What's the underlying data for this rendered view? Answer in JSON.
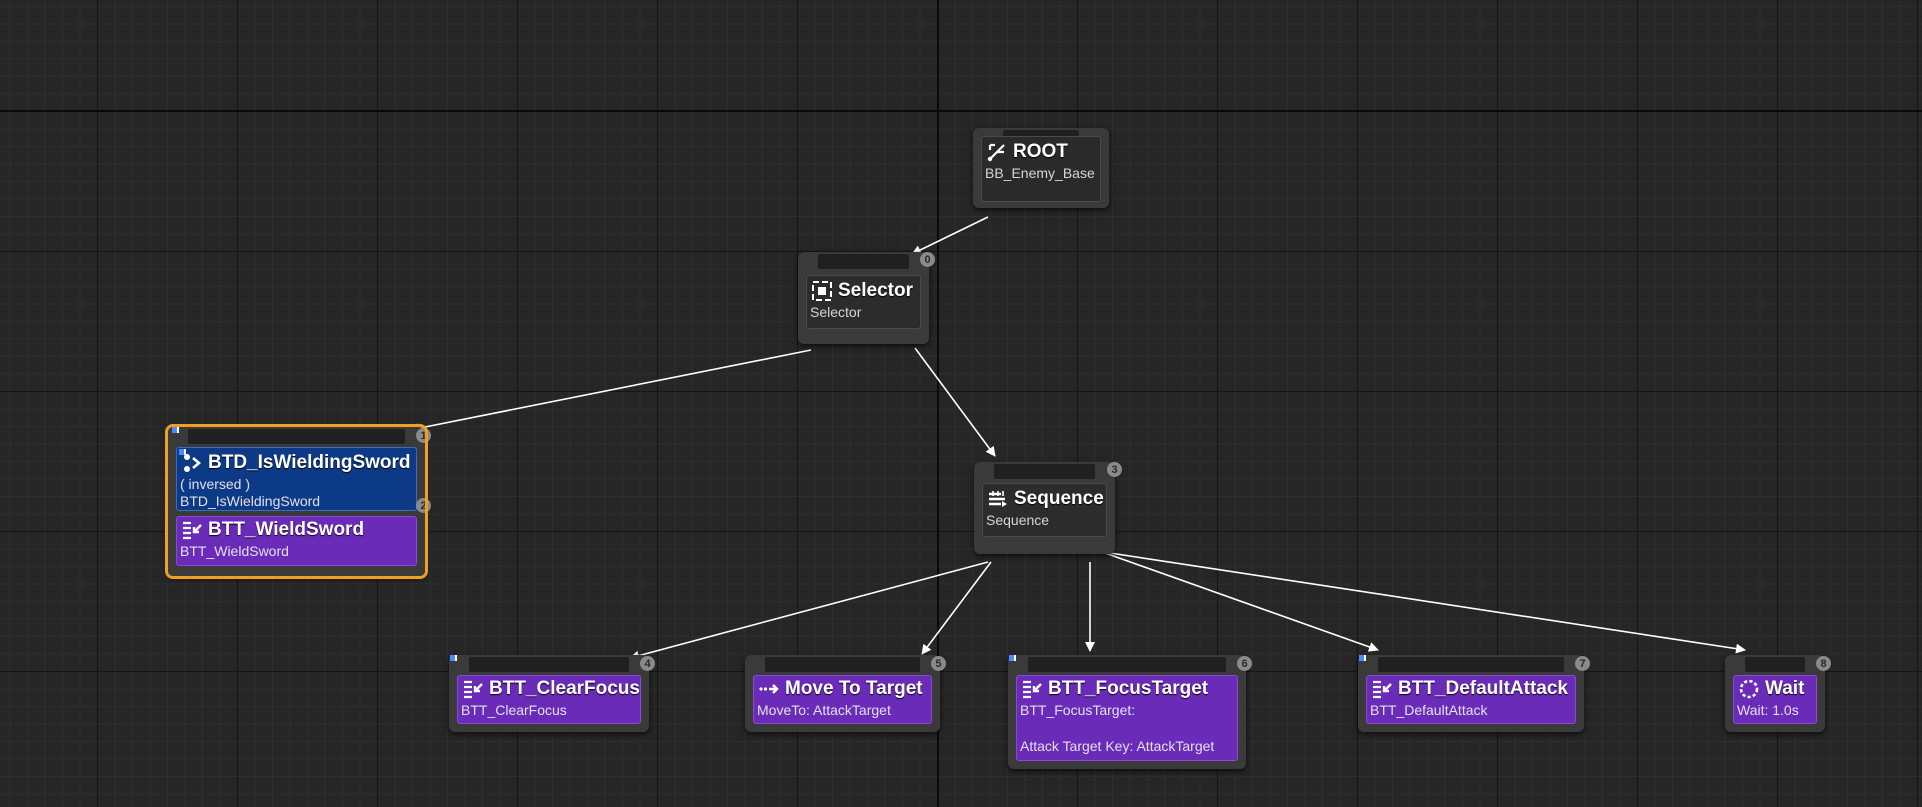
{
  "colors": {
    "composite": "#3a3a3a",
    "task": "#6a2bb8",
    "decorator": "#0d3a86",
    "selection": "#f0a020",
    "wire": "#ffffff"
  },
  "nodes": {
    "root": {
      "title": "ROOT",
      "subtitle": "BB_Enemy_Base",
      "icon": "root-icon"
    },
    "selector": {
      "title": "Selector",
      "subtitle": "Selector",
      "index": "0",
      "icon": "selector-icon"
    },
    "sequence": {
      "title": "Sequence",
      "subtitle": "Sequence",
      "index": "3",
      "icon": "sequence-icon"
    },
    "decorator": {
      "title": "BTD_IsWieldingSword",
      "line1": "( inversed )",
      "line2": "BTD_IsWieldingSword",
      "index": "2",
      "icon": "decorator-icon"
    },
    "wield_sword": {
      "title": "BTT_WieldSword",
      "subtitle": "BTT_WieldSword",
      "index": "1",
      "icon": "task-icon"
    },
    "clear_focus": {
      "title": "BTT_ClearFocus",
      "subtitle": "BTT_ClearFocus",
      "index": "4",
      "icon": "task-icon"
    },
    "move_to": {
      "title": "Move To Target",
      "subtitle": "MoveTo: AttackTarget",
      "index": "5",
      "icon": "move-to-icon"
    },
    "focus_target": {
      "title": "BTT_FocusTarget",
      "subtitle": "BTT_FocusTarget:",
      "detail": "Attack Target Key: AttackTarget",
      "index": "6",
      "icon": "task-icon"
    },
    "default_attack": {
      "title": "BTT_DefaultAttack",
      "subtitle": "BTT_DefaultAttack",
      "index": "7",
      "icon": "task-icon"
    },
    "wait": {
      "title": "Wait",
      "subtitle": "Wait: 1.0s",
      "index": "8",
      "icon": "wait-icon"
    }
  },
  "edges": [
    [
      "root",
      "selector"
    ],
    [
      "selector",
      "wield_sword"
    ],
    [
      "selector",
      "sequence"
    ],
    [
      "sequence",
      "clear_focus"
    ],
    [
      "sequence",
      "move_to"
    ],
    [
      "sequence",
      "focus_target"
    ],
    [
      "sequence",
      "default_attack"
    ],
    [
      "sequence",
      "wait"
    ]
  ]
}
